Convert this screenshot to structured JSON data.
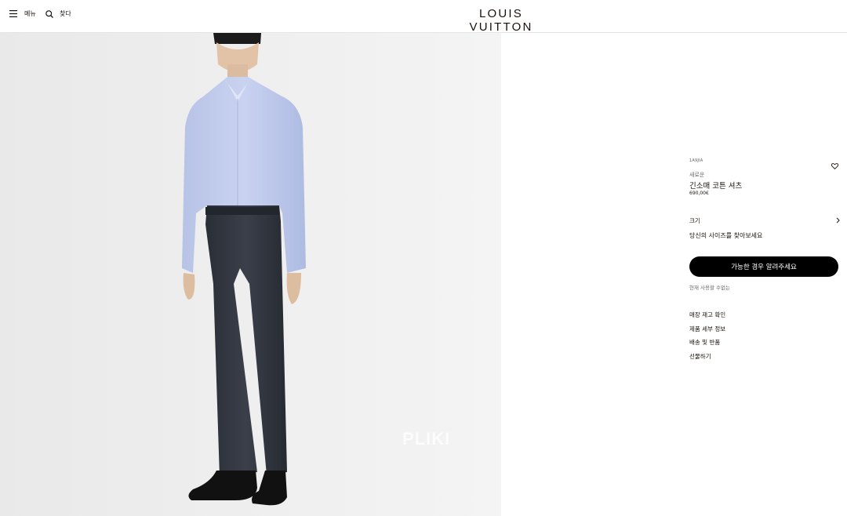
{
  "header": {
    "menu_label": "메뉴",
    "search_label": "찾다",
    "brand": "LOUIS VUITTON"
  },
  "hero": {
    "watermark": "PLIKI"
  },
  "product": {
    "sku": "1A9JIA",
    "tag": "새로운",
    "title": "긴소매 코튼 셔츠",
    "price": "690,00€",
    "size_label": "크기",
    "find_size": "당신의 사이즈를 찾아보세요",
    "notify_button": "가능한 경우 알려주세요",
    "availability": "현재 사용할 수없는"
  },
  "links": [
    {
      "label": "매장 재고 확인"
    },
    {
      "label": "제품 세부 정보"
    },
    {
      "label": "배송 및 반품"
    },
    {
      "label": "선물하기"
    }
  ],
  "icons": {
    "menu": "hamburger-icon",
    "search": "magnifier-icon",
    "wishlist": "heart-icon",
    "size_chevron": "chevron-right-icon"
  },
  "colors": {
    "text": "#19110b",
    "button_bg": "#000000",
    "button_text": "#ffffff",
    "photo_bg": "#efefef"
  }
}
